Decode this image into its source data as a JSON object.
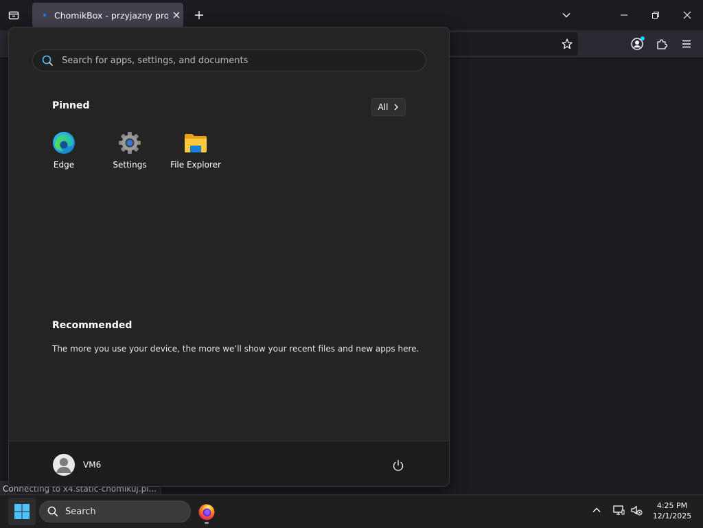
{
  "browser": {
    "tab_title": "ChomikBox - przyjazny program",
    "status_text": "Connecting to x4.static-chomikuj.pl..."
  },
  "start_menu": {
    "search_placeholder": "Search for apps, settings, and documents",
    "pinned_title": "Pinned",
    "all_label": "All",
    "pinned_apps": [
      {
        "label": "Edge",
        "icon": "edge-icon"
      },
      {
        "label": "Settings",
        "icon": "settings-gear-icon"
      },
      {
        "label": "File Explorer",
        "icon": "folder-icon"
      }
    ],
    "recommended_title": "Recommended",
    "recommended_text": "The more you use your device, the more we’ll show your recent files and new apps here.",
    "user_name": "VM6"
  },
  "taskbar": {
    "search_label": "Search",
    "time": "4:25 PM",
    "date": "12/1/2025"
  },
  "colors": {
    "accent": "#0078d4",
    "start_bg": "#242424",
    "taskbar_bg": "#1f1f1f",
    "browser_tab_active": "#42414d"
  }
}
